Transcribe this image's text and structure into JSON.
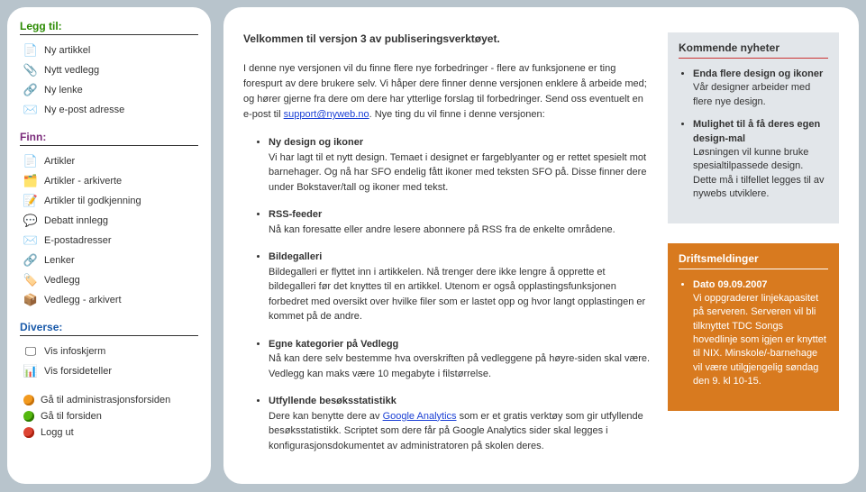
{
  "sidebar": {
    "sections": [
      {
        "key": "add",
        "title": "Legg til:",
        "color": "green",
        "items": [
          {
            "label": "Ny artikkel",
            "icon": "📄",
            "name": "new-article"
          },
          {
            "label": "Nytt vedlegg",
            "icon": "📎",
            "name": "new-attachment"
          },
          {
            "label": "Ny lenke",
            "icon": "🔗",
            "name": "new-link"
          },
          {
            "label": "Ny e-post adresse",
            "icon": "✉️",
            "name": "new-email"
          }
        ]
      },
      {
        "key": "find",
        "title": "Finn:",
        "color": "purple",
        "items": [
          {
            "label": "Artikler",
            "icon": "📄",
            "name": "articles"
          },
          {
            "label": "Artikler - arkiverte",
            "icon": "🗂️",
            "name": "articles-archived"
          },
          {
            "label": "Artikler til godkjenning",
            "icon": "📝",
            "name": "articles-approve"
          },
          {
            "label": "Debatt innlegg",
            "icon": "💬",
            "name": "debate-posts"
          },
          {
            "label": "E-postadresser",
            "icon": "✉️",
            "name": "emails"
          },
          {
            "label": "Lenker",
            "icon": "🔗",
            "name": "links"
          },
          {
            "label": "Vedlegg",
            "icon": "🏷️",
            "name": "attachments"
          },
          {
            "label": "Vedlegg - arkivert",
            "icon": "📦",
            "name": "attachments-archived"
          }
        ]
      },
      {
        "key": "misc",
        "title": "Diverse:",
        "color": "blue",
        "items": [
          {
            "label": "Vis infoskjerm",
            "icon": "🖵",
            "name": "show-infoscreen"
          },
          {
            "label": "Vis forsideteller",
            "icon": "📊",
            "name": "show-counter"
          }
        ]
      }
    ],
    "bottom": [
      {
        "label": "Gå til administrasjonsforsiden",
        "dot": "orange",
        "name": "admin-front"
      },
      {
        "label": "Gå til forsiden",
        "dot": "green",
        "name": "goto-front"
      },
      {
        "label": "Logg ut",
        "dot": "red",
        "name": "logout"
      }
    ]
  },
  "content": {
    "title": "Velkommen til versjon 3 av publiseringsverktøyet.",
    "intro_pre": "I denne nye versjonen vil du finne flere nye forbedringer - flere av funksjonene er ting forespurt av dere brukere selv. Vi håper dere finner denne versjonen enklere å arbeide med; og hører gjerne fra dere om dere har ytterlige forslag til forbedringer. Send oss eventuelt en e-post til ",
    "intro_link": "support@nyweb.no",
    "intro_post": ". Nye ting du vil finne i denne versjonen:",
    "features": [
      {
        "h": "Ny design og ikoner",
        "b": "Vi har lagt til et nytt design. Temaet i designet er fargeblyanter og er rettet spesielt mot barnehager. Og nå har SFO endelig fått ikoner med teksten SFO på. Disse finner dere under Bokstaver/tall og ikoner med tekst."
      },
      {
        "h": "RSS-feeder",
        "b": "Nå kan foresatte eller andre lesere abonnere på RSS fra de enkelte områdene."
      },
      {
        "h": "Bildegalleri",
        "b": "Bildegalleri er flyttet inn i artikkelen. Nå trenger dere ikke lengre å opprette et bildegalleri før det knyttes til en artikkel. Utenom er også opplastingsfunksjonen forbedret med oversikt over hvilke filer som er lastet opp og hvor langt opplastingen er kommet på de andre."
      },
      {
        "h": "Egne kategorier på Vedlegg",
        "b": "Nå kan dere selv bestemme hva overskriften på vedleggene på høyre-siden skal være. Vedlegg kan maks være 10 megabyte i filstørrelse."
      },
      {
        "h": "Utfyllende besøksstatistikk",
        "b_pre": "Dere kan benytte dere av ",
        "b_link": "Google Analytics",
        "b_post": " som er et gratis verktøy som gir utfyllende besøksstatistikk. Scriptet som dere får på Google Analytics sider skal legges i konfigurasjonsdokumentet av administratoren på skolen deres."
      }
    ]
  },
  "right": {
    "news": {
      "title": "Kommende nyheter",
      "items": [
        {
          "h": "Enda flere design og ikoner",
          "b": "Vår designer arbeider med flere nye design."
        },
        {
          "h": "Mulighet til å få deres egen design-mal",
          "b": "Løsningen vil kunne bruke spesialtilpassede design. Dette må i tilfellet legges til av nywebs utviklere."
        }
      ]
    },
    "ops": {
      "title": "Driftsmeldinger",
      "items": [
        {
          "h": "Dato 09.09.2007",
          "b": "Vi oppgraderer linjekapasitet på serveren. Serveren vil bli tilknyttet TDC Songs hovedlinje som igjen er knyttet til NIX. Minskole/-barnehage vil være utilgjengelig søndag den 9. kl 10-15."
        }
      ]
    }
  }
}
